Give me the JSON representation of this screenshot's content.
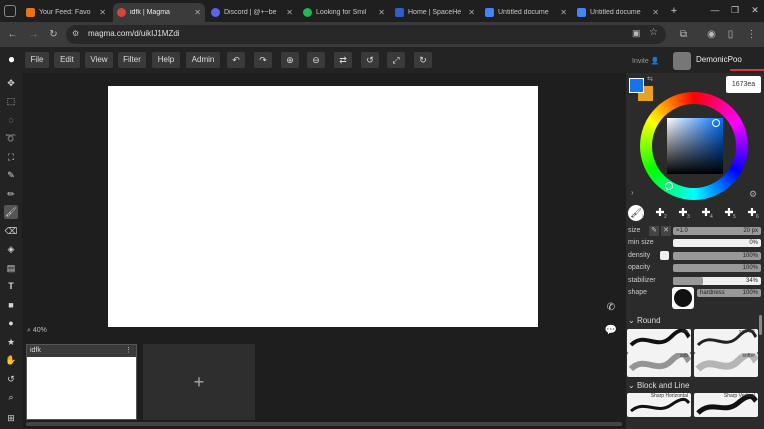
{
  "browser": {
    "tabs": [
      {
        "label": "Your Feed: Favo",
        "icon": "dev-icon",
        "color": "#e8711a",
        "active": false
      },
      {
        "label": "idfk | Magma",
        "icon": "magma-icon",
        "color": "#d9433b",
        "active": true
      },
      {
        "label": "Discord | @+~be",
        "icon": "discord-icon",
        "color": "#5865f2",
        "active": false
      },
      {
        "label": "Looking for Smil",
        "icon": "spotify-icon",
        "color": "#1db954",
        "active": false
      },
      {
        "label": "Home | SpaceHe",
        "icon": "spacehey-icon",
        "color": "#2f5fc9",
        "active": false
      },
      {
        "label": "Untitled docume",
        "icon": "docs-icon",
        "color": "#4285f4",
        "active": false
      },
      {
        "label": "Untitled docume",
        "icon": "docs-icon",
        "color": "#4285f4",
        "active": false
      }
    ],
    "new_tab": "+",
    "url": "magma.com/d/uikIJ1MZdi"
  },
  "menu": {
    "items": [
      "File",
      "Edit",
      "View",
      "Filter",
      "Help",
      "Admin"
    ],
    "tools": [
      "undo-icon",
      "redo-icon",
      "zoom-in-icon",
      "zoom-out-icon",
      "swap-icon",
      "rotate-left-icon",
      "fit-icon",
      "rotate-right-icon"
    ]
  },
  "zoom": "40%",
  "layer": {
    "name": "idfk",
    "menu": "⋮",
    "add": "+"
  },
  "user": {
    "invite": "Invite",
    "name": "DemonicPoo"
  },
  "color": {
    "primary": "#1673ea",
    "secondary": "#e8a02a",
    "hex": "1673ea"
  },
  "brush": {
    "size_label": "size",
    "size_value": "20 px",
    "size_mult": "×1.0",
    "rows": [
      {
        "label": "min size",
        "value": "0%",
        "fill": 0.0
      },
      {
        "label": "density",
        "value": "100%",
        "fill": 1.0
      },
      {
        "label": "opacity",
        "value": "100%",
        "fill": 1.0
      },
      {
        "label": "stabilizer",
        "value": "34%",
        "fill": 0.34
      }
    ],
    "shape_label": "shape",
    "hardness": "hardness",
    "hardness_value": "100%",
    "slots": [
      "1",
      "2",
      "3",
      "4",
      "5",
      "6"
    ]
  },
  "brushes": {
    "round_title": "Round",
    "round": [
      "ink",
      "soft ink",
      "sob",
      "softer"
    ],
    "block_title": "Block and Line",
    "block": [
      "Sharp Horizontal",
      "Sharp Vertical"
    ]
  }
}
